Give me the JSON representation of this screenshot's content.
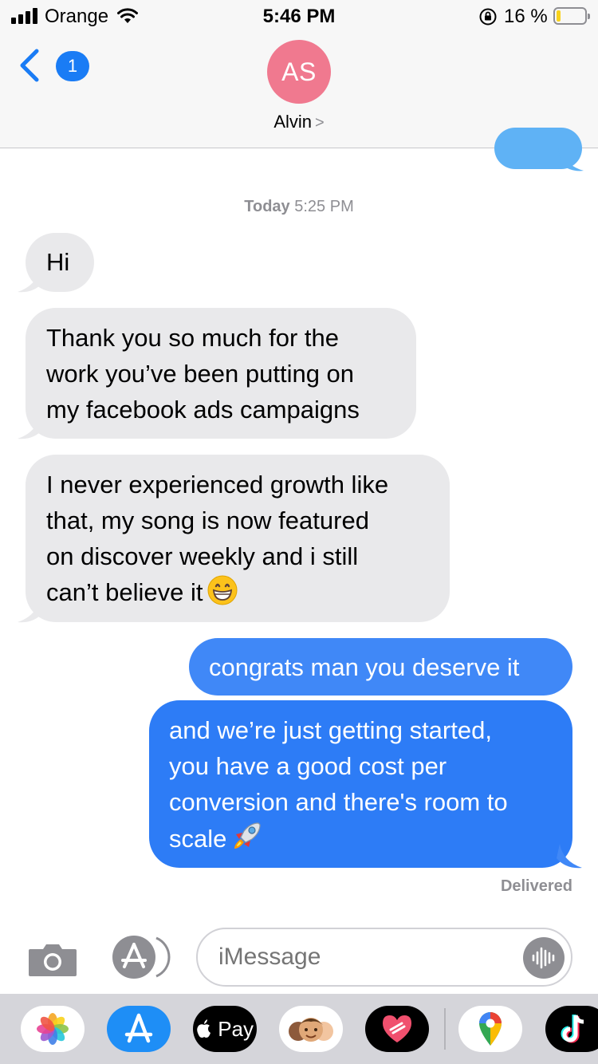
{
  "status_bar": {
    "carrier": "Orange",
    "time": "5:46 PM",
    "battery_percent": "16 %",
    "battery_level": 0.16,
    "battery_color": "#f8d21c"
  },
  "header": {
    "back_badge": "1",
    "avatar_initials": "AS",
    "contact_name": "Alvin",
    "avatar_color": "#f0798f"
  },
  "thread": {
    "timestamp_day": "Today",
    "timestamp_time": "5:25 PM",
    "messages": [
      {
        "direction": "incoming",
        "text": "Hi"
      },
      {
        "direction": "incoming",
        "lines": [
          "Thank you so much for the",
          "work you’ve been putting on",
          "my facebook ads campaigns"
        ]
      },
      {
        "direction": "incoming",
        "lines": [
          "I never experienced growth like",
          "that, my song is now featured",
          "on discover weekly and i still",
          "can’t believe it"
        ],
        "emoji": "grinning-face-emoji"
      },
      {
        "direction": "outgoing",
        "text": "congrats man you deserve it"
      },
      {
        "direction": "outgoing",
        "lines": [
          "and we’re just getting started,",
          "you have a good cost per",
          "conversion and there's room to",
          "scale"
        ],
        "emoji": "rocket-emoji"
      }
    ],
    "delivery_status": "Delivered"
  },
  "input_bar": {
    "placeholder": "iMessage"
  },
  "app_drawer": {
    "apps": [
      "photos-icon",
      "app-store-icon",
      "apple-pay-icon",
      "memoji-icon",
      "heart-app-icon",
      "maps-icon",
      "tiktok-icon"
    ],
    "apple_pay_label": "Pay"
  },
  "colors": {
    "incoming_bubble": "#e9e9eb",
    "outgoing_bubble": "#2d7cf6",
    "accent": "#1a7cf5"
  }
}
